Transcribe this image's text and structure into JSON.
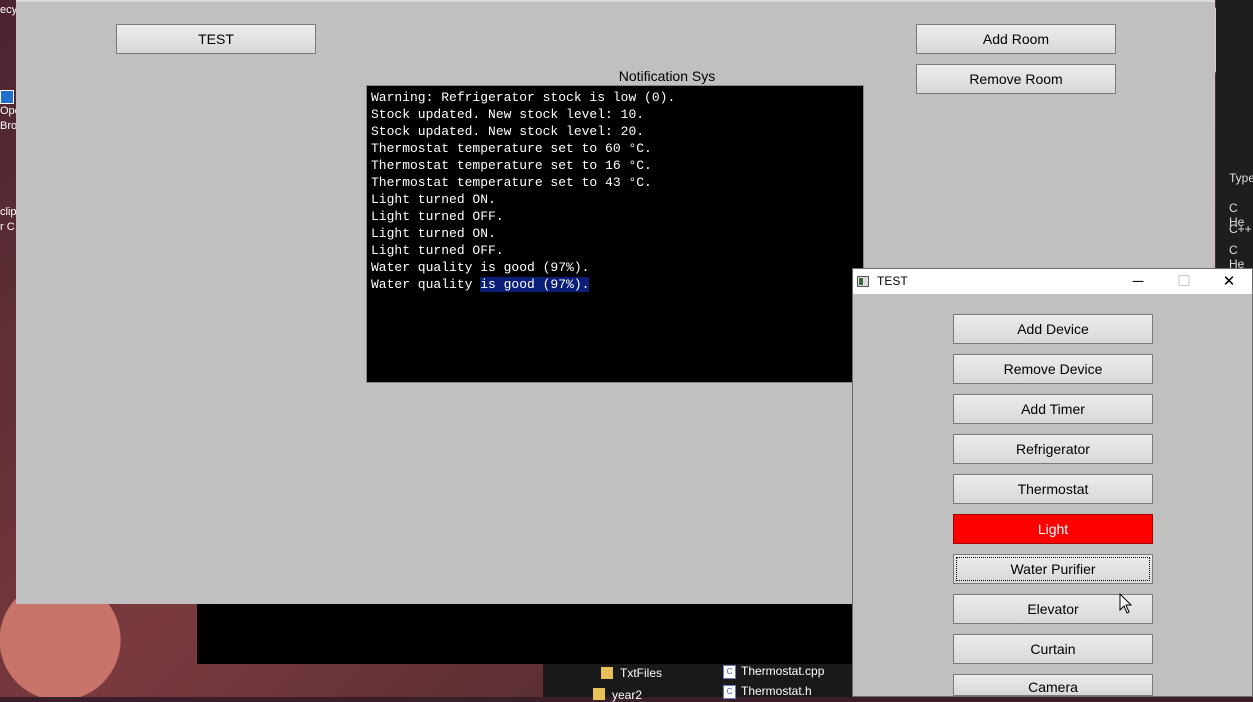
{
  "desktop": {
    "left_texts": [
      "ecy",
      "Ope",
      "Bro",
      "clip",
      "r C"
    ],
    "explorer": {
      "folders": [
        "TxtFiles",
        "year2"
      ],
      "files": [
        "Thermostat.cpp",
        "Thermostat.h"
      ]
    },
    "ide_rows": [
      "Type",
      "C He",
      "C++",
      "C He"
    ]
  },
  "main_window": {
    "test_button": "TEST",
    "add_room_button": "Add Room",
    "remove_room_button": "Remove Room",
    "notification_title": "Notification Sys",
    "console_lines": [
      "Warning: Refrigerator stock is low (0).",
      "Stock updated. New stock level: 10.",
      "Stock updated. New stock level: 20.",
      "Thermostat temperature set to 60 °C.",
      "Thermostat temperature set to 16 °C.",
      "Thermostat temperature set to 43 °C.",
      "Light turned ON.",
      "Light turned OFF.",
      "Light turned ON.",
      "Light turned OFF.",
      "Water quality is good (97%)."
    ],
    "console_last_plain": "Water quality ",
    "console_last_selected": "is good (97%)."
  },
  "dialog": {
    "title": "TEST",
    "minimize": "─",
    "maximize": "☐",
    "close": "✕",
    "buttons": {
      "add_device": "Add Device",
      "remove_device": "Remove Device",
      "add_timer": "Add Timer",
      "refrigerator": "Refrigerator",
      "thermostat": "Thermostat",
      "light": "Light",
      "water_purifier": "Water Purifier",
      "elevator": "Elevator",
      "curtain": "Curtain",
      "camera": "Camera"
    },
    "active_color": "#ff0000"
  }
}
